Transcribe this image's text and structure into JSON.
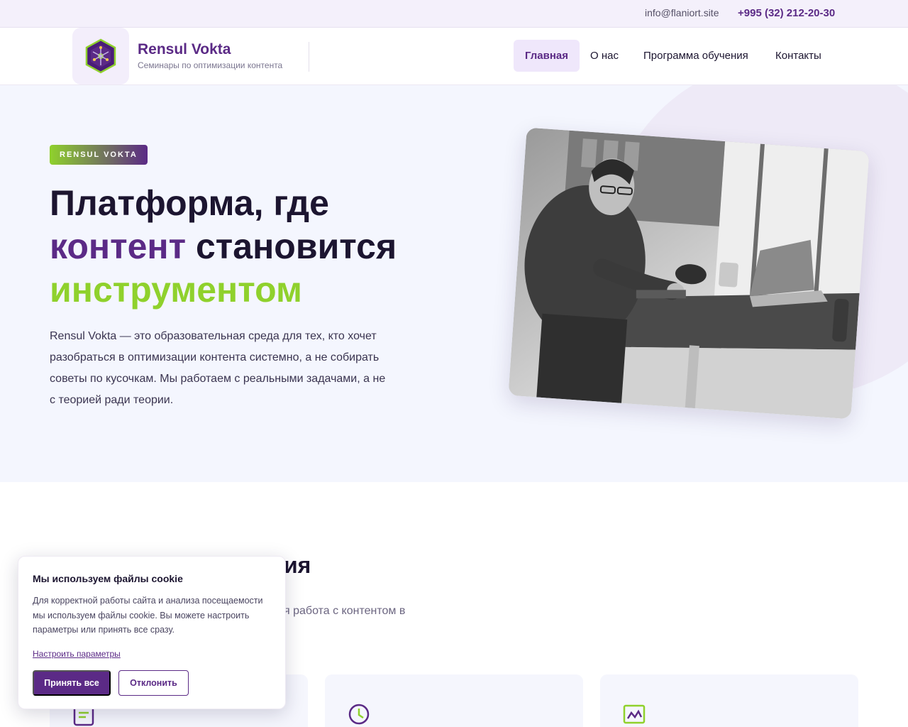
{
  "topbar": {
    "email": "info@flaniort.site",
    "phone": "+995 (32) 212-20-30"
  },
  "header": {
    "brand_name": "Rensul Vokta",
    "brand_subtitle": "Семинары по оптимизации контента",
    "nav": [
      {
        "label": "Главная",
        "active": true
      },
      {
        "label": "О нас",
        "active": false
      },
      {
        "label": "Программа обучения",
        "active": false
      },
      {
        "label": "Контакты",
        "active": false
      }
    ]
  },
  "hero": {
    "badge": "RENSUL VOKTA",
    "title_line1": "Платформа, где",
    "title_highlight_purple": "контент",
    "title_line2_rest": " становится",
    "title_highlight_green": "инструментом",
    "description": "Rensul Vokta — это образовательная среда для тех, кто хочет разобраться в оптимизации контента системно, а не собирать советы по кусочкам. Мы работаем с реальными задачами, а не с теорией ради теории.",
    "image_icon": "man-at-laptop-photo"
  },
  "section": {
    "title_visible": "ия",
    "text_visible": "я работа с контентом в"
  },
  "cards": [
    {
      "icon": "document-icon"
    },
    {
      "icon": "clock-icon"
    },
    {
      "icon": "chart-icon"
    }
  ],
  "cookie": {
    "title": "Мы используем файлы cookie",
    "text": "Для корректной работы сайта и анализа посещаемости мы используем файлы cookie. Вы можете настроить параметры или принять все сразу.",
    "settings_link": "Настроить параметры",
    "accept": "Принять все",
    "decline": "Отклонить"
  },
  "colors": {
    "brand_purple": "#5b2a86",
    "brand_green": "#8fd12c",
    "hero_bg": "#f4f6fe",
    "topbar_bg": "#f4f0fb"
  }
}
